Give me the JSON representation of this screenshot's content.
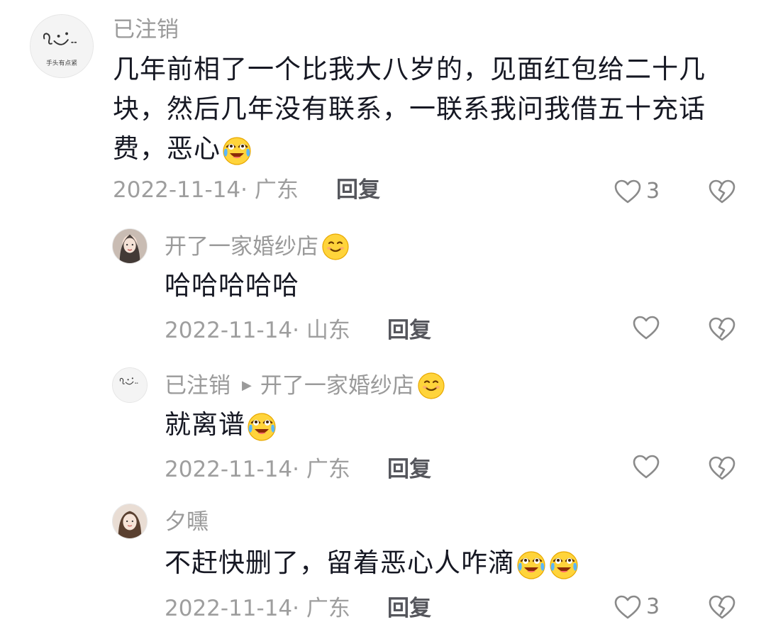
{
  "comments": [
    {
      "username": "已注销",
      "avatar_text": "手头有点紧",
      "text_lines": [
        "几年前相了一个比我大八岁的，见面红包给二十几",
        "块，然后几年没有联系，一联系我问我借五十充话",
        "费，恶心"
      ],
      "emoji": "crying-laughing-emoji",
      "date_location": "2022-11-14· 广东",
      "reply_label": "回复",
      "like_count": "3"
    },
    {
      "username": "开了一家婚纱店",
      "name_emoji": "smiling-face-emoji",
      "text": "哈哈哈哈哈",
      "date_location": "2022-11-14· 山东",
      "reply_label": "回复",
      "like_count": ""
    },
    {
      "username": "已注销",
      "avatar_text": "手头有点紧",
      "reply_to": "开了一家婚纱店",
      "name_emoji": "smiling-face-emoji",
      "text": "就离谱",
      "emoji": "crying-laughing-emoji",
      "date_location": "2022-11-14· 广东",
      "reply_label": "回复",
      "like_count": ""
    },
    {
      "username": "夕曛",
      "text": "不赶快删了，留着恶心人咋滴",
      "emoji": "crying-laughing-emoji",
      "date_location": "2022-11-14· 广东",
      "reply_label": "回复",
      "like_count": "3"
    }
  ],
  "colors": {
    "username": "#9a9a9a",
    "content": "#161823",
    "meta": "#9e9e9e",
    "reply": "#55565c",
    "icon": "#888888"
  }
}
